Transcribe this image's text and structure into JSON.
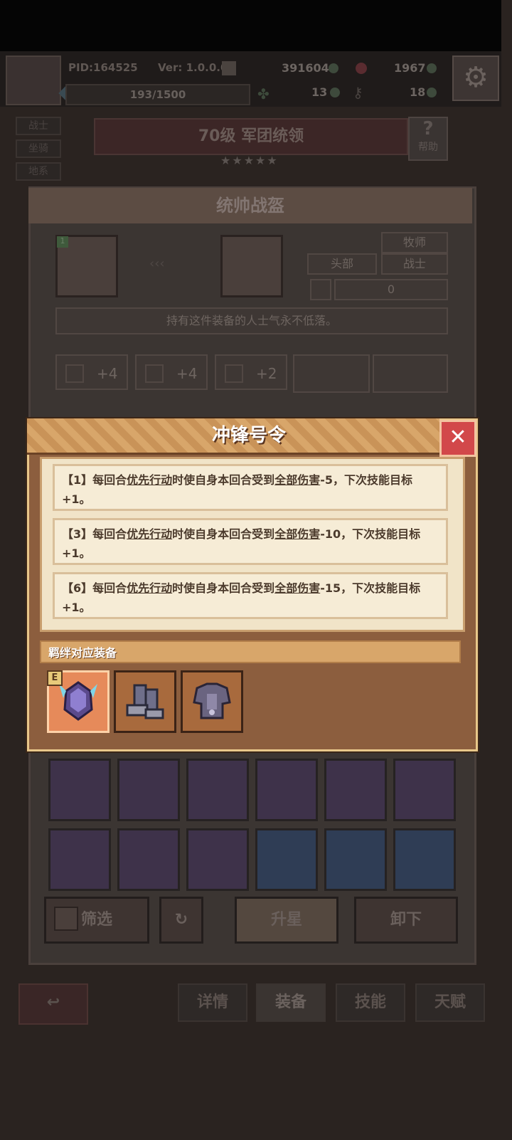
{
  "topbar": {
    "pid": "PID:164525",
    "version": "Ver: 1.0.0.0",
    "gold": "391604",
    "gems": "1967",
    "exp": "193/1500",
    "res3": "13",
    "res4": "18"
  },
  "sidetabs": [
    "战士",
    "坐骑",
    "地系"
  ],
  "level_title": "70级 军团统领",
  "help_label": "帮助",
  "panel": {
    "title": "统帅战盔",
    "tag_class1": "牧师",
    "tag_slot": "头部",
    "tag_class2": "战士",
    "value": "0",
    "desc": "持有这件装备的人士气永不低落。",
    "stats": [
      "+4",
      "+4",
      "+2"
    ]
  },
  "modal": {
    "title": "冲锋号令",
    "rows": [
      {
        "tier": "【1】",
        "pre": "每回合",
        "key1": "优先行动",
        "mid": "时使自身本回合受到",
        "key2": "全部伤害",
        "post": "-5，下次技能目标+1。"
      },
      {
        "tier": "【3】",
        "pre": "每回合",
        "key1": "优先行动",
        "mid": "时使自身本回合受到",
        "key2": "全部伤害",
        "post": "-10，下次技能目标+1。"
      },
      {
        "tier": "【6】",
        "pre": "每回合",
        "key1": "优先行动",
        "mid": "时使自身本回合受到",
        "key2": "全部伤害",
        "post": "-15，下次技能目标+1。"
      }
    ],
    "bond_header": "羁绊对应装备",
    "equipped_badge": "E"
  },
  "buttons": {
    "filter": "筛选",
    "star_up": "升星",
    "unequip": "卸下"
  },
  "bottom_nav": [
    "详情",
    "装备",
    "技能",
    "天赋"
  ],
  "colors": {
    "modal_bg": "#8c5e3e",
    "modal_border": "#e8c78a",
    "close_red": "#d2484a",
    "row_text": "#4b3a2c"
  }
}
